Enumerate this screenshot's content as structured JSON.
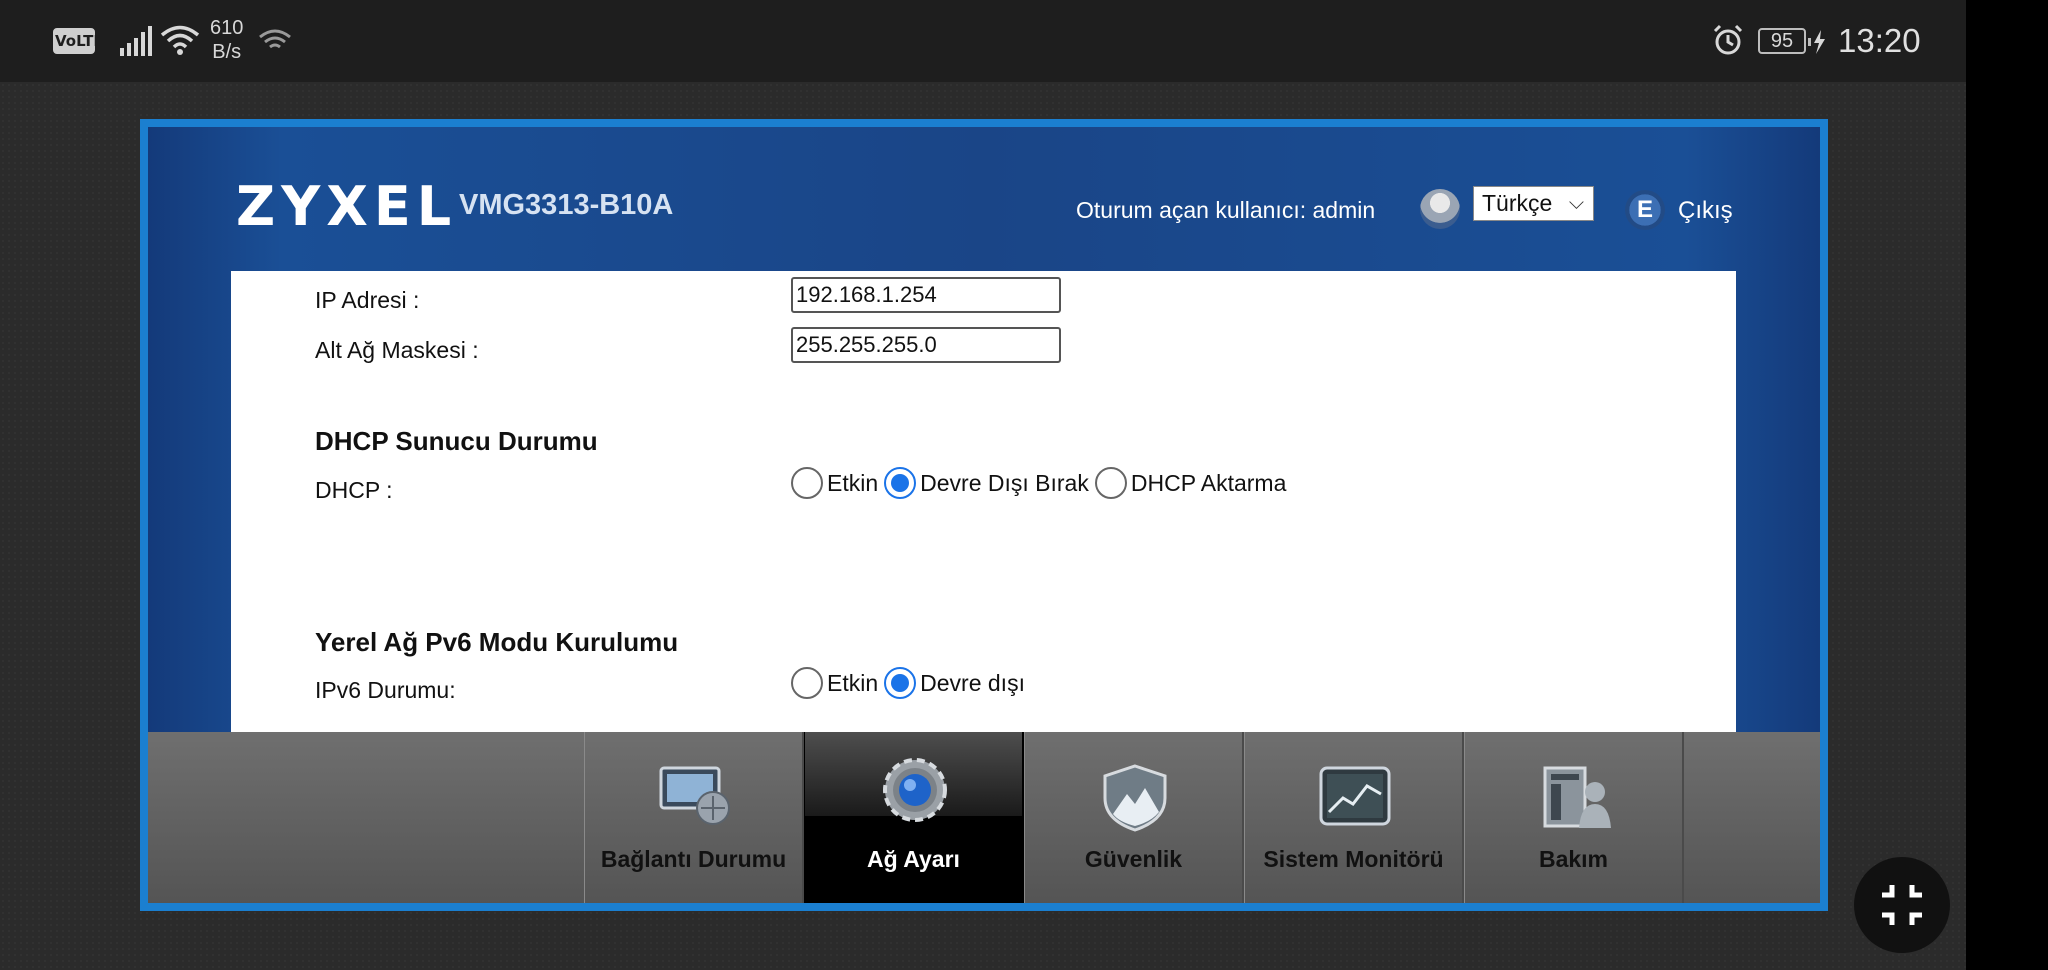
{
  "status_bar": {
    "volte": "VoLTE",
    "net_speed_value": "610",
    "net_speed_unit": "B/s",
    "battery": "95",
    "time": "13:20",
    "icons": [
      "signal-icon",
      "wifi-icon",
      "hotspot-icon",
      "alarm-icon",
      "charging-icon"
    ]
  },
  "header": {
    "brand": "ZYXEL",
    "model": "VMG3313-B10A",
    "user_label": "Oturum açan kullanıcı:  admin",
    "language": "Türkçe",
    "logout": "Çıkış"
  },
  "lan": {
    "ip_label": "IP Adresi :",
    "ip_value": "192.168.1.254",
    "mask_label": "Alt Ağ Maskesi :",
    "mask_value": "255.255.255.0"
  },
  "dhcp": {
    "title": "DHCP Sunucu Durumu",
    "label": "DHCP :",
    "options": [
      "Etkin",
      "Devre Dışı Bırak",
      "DHCP Aktarma"
    ],
    "selected": "Devre Dışı Bırak"
  },
  "ipv6": {
    "title": "Yerel Ağ Pv6 Modu Kurulumu",
    "label": "IPv6 Durumu:",
    "options": [
      "Etkin",
      "Devre dışı"
    ],
    "selected": "Devre dışı"
  },
  "nav": {
    "items": [
      "Bağlantı Durumu",
      "Ağ Ayarı",
      "Güvenlik",
      "Sistem Monitörü",
      "Bakım"
    ],
    "active": "Ağ Ayarı"
  },
  "colors": {
    "frame": "#1b7fd0",
    "header_bg": "#1a4587",
    "radio_on": "#1a73e8"
  }
}
